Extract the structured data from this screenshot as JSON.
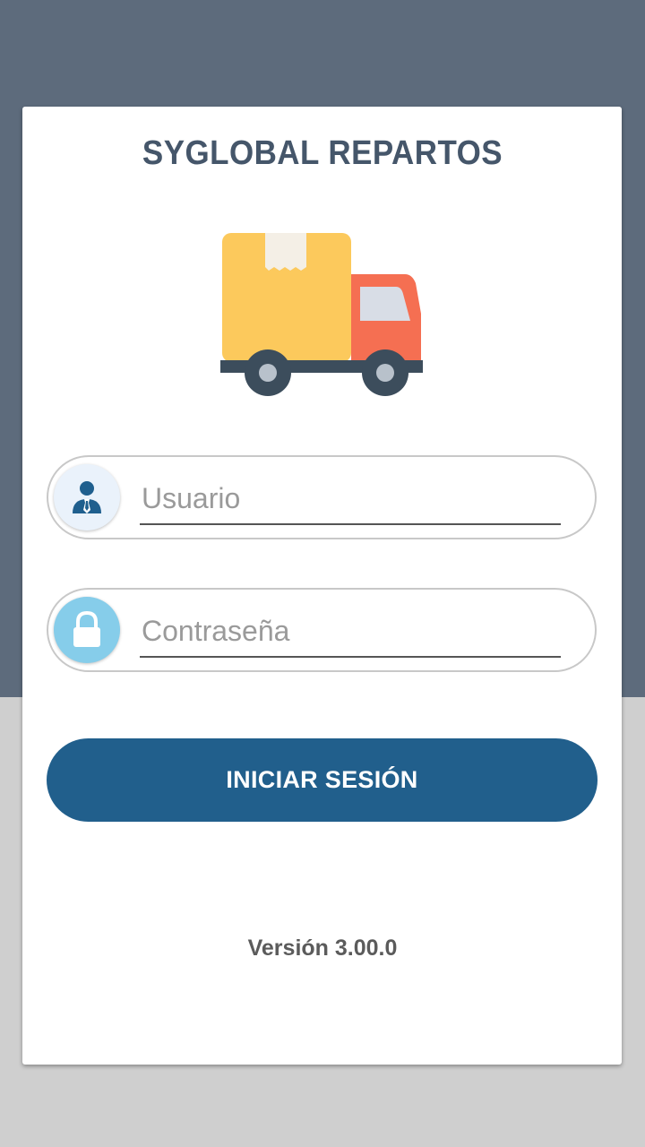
{
  "app": {
    "title": "SYGLOBAL REPARTOS",
    "logo_icon": "delivery-truck-icon"
  },
  "login_form": {
    "username": {
      "placeholder": "Usuario",
      "value": "",
      "icon": "user-icon"
    },
    "password": {
      "placeholder": "Contraseña",
      "value": "",
      "icon": "lock-icon"
    },
    "submit_label": "INICIAR SESIÓN"
  },
  "footer": {
    "version": "Versión 3.00.0"
  },
  "colors": {
    "header_background": "#5d6b7c",
    "page_background": "#cfcfcf",
    "primary_button": "#215f8c",
    "title_text": "#45566a",
    "truck_cargo": "#fcc95c",
    "truck_cab": "#f56f52",
    "password_badge": "#86cdea"
  }
}
